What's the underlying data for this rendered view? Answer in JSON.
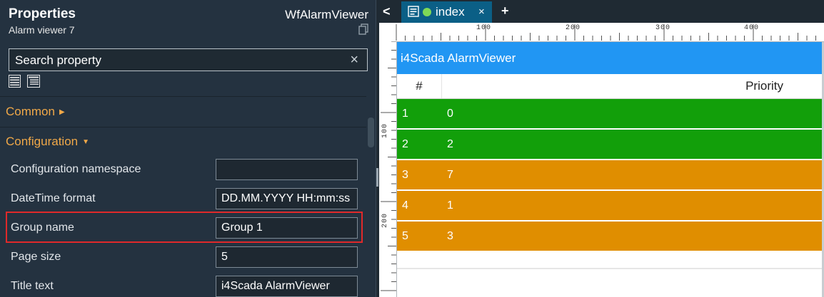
{
  "properties": {
    "title": "Properties",
    "subtitle": "Alarm viewer 7",
    "control_type": "WfAlarmViewer",
    "search": {
      "placeholder": "Search property",
      "value": ""
    },
    "sections": [
      {
        "label": "Common",
        "expanded": false
      },
      {
        "label": "Configuration",
        "expanded": true
      }
    ],
    "fields": [
      {
        "label": "Configuration namespace",
        "value": ""
      },
      {
        "label": "DateTime format",
        "value": "DD.MM.YYYY HH:mm:ss"
      },
      {
        "label": "Group name",
        "value": "Group 1",
        "highlighted": true
      },
      {
        "label": "Page size",
        "value": "5"
      },
      {
        "label": "Title text",
        "value": "i4Scada AlarmViewer"
      }
    ]
  },
  "editor": {
    "tab": {
      "label": "index",
      "close": "×",
      "status_color": "#7ed957"
    },
    "back_glyph": "<",
    "add_glyph": "+",
    "ruler_top_labels": [
      "100",
      "200",
      "300",
      "400"
    ],
    "ruler_left_labels": [
      "100",
      "200"
    ]
  },
  "alarm_viewer": {
    "title": "i4Scada AlarmViewer",
    "columns": [
      "#",
      "Priority"
    ],
    "rows": [
      {
        "num": "1",
        "priority": "0",
        "color": "#129f0a"
      },
      {
        "num": "2",
        "priority": "2",
        "color": "#129f0a"
      },
      {
        "num": "3",
        "priority": "7",
        "color": "#e08e00"
      },
      {
        "num": "4",
        "priority": "1",
        "color": "#e08e00"
      },
      {
        "num": "5",
        "priority": "3",
        "color": "#e08e00"
      }
    ]
  },
  "colors": {
    "panel_bg": "#243240",
    "section_accent": "#f0a848",
    "highlight_border": "#e0292a",
    "viewer_header": "#2196f3",
    "tab_active": "#0b5f86"
  }
}
